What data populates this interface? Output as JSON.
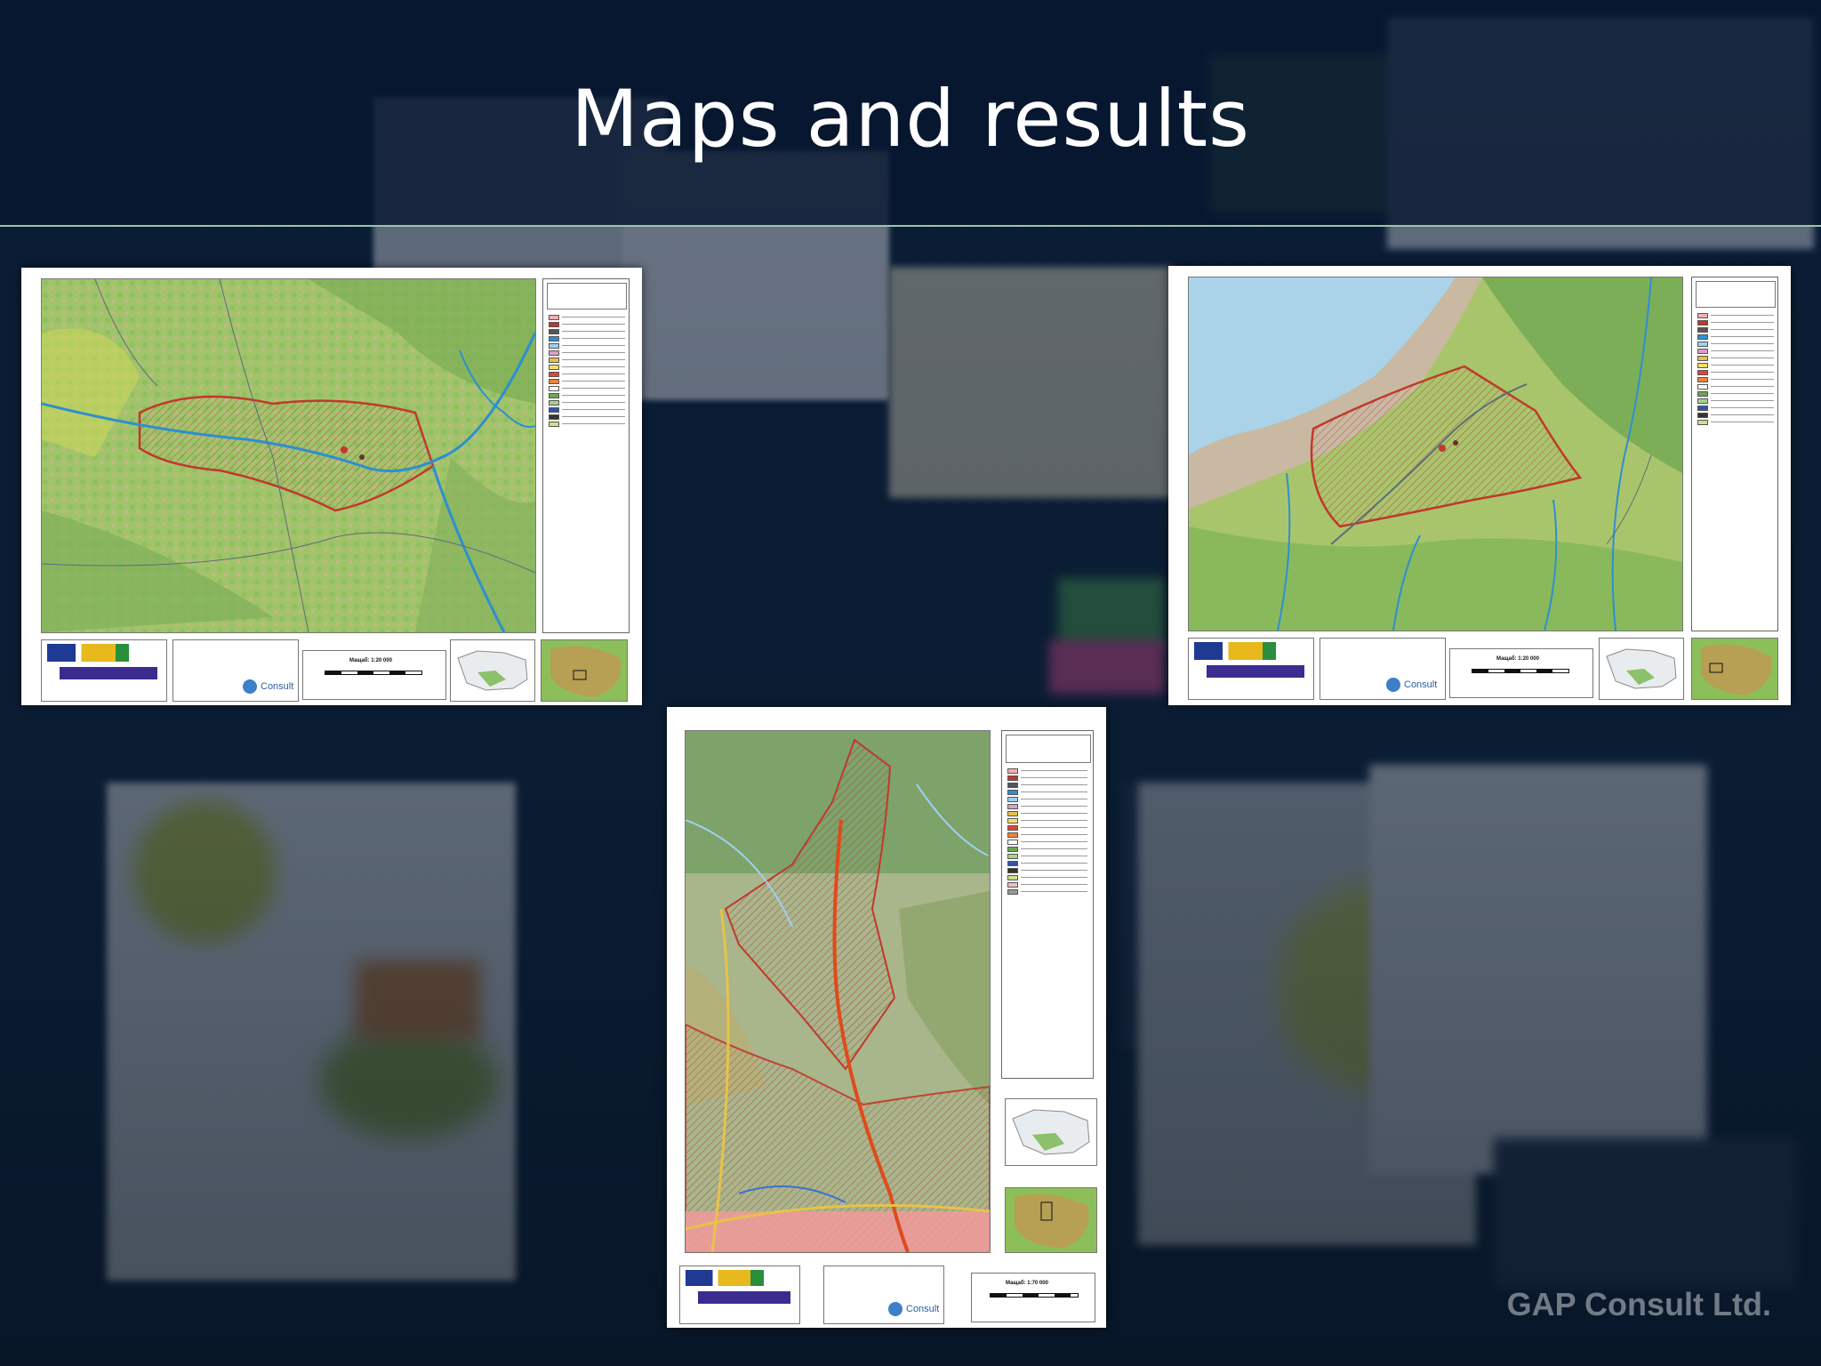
{
  "slide": {
    "title": "Maps and results",
    "watermark": "GAP Consult Ltd.",
    "colors": {
      "title_band": "#06162f",
      "title_text": "#ffffff",
      "divider": "#9cc6a6",
      "flood_zone": "#c0392b",
      "water": "#2d8fd0"
    }
  },
  "maps": [
    {
      "orientation": "landscape",
      "scale_label": "Мащаб: 1:20 000",
      "logo_label": "Consult"
    },
    {
      "orientation": "landscape",
      "scale_label": "Мащаб: 1:20 000",
      "logo_label": "Consult"
    },
    {
      "orientation": "portrait",
      "scale_label": "Мащаб: 1:70 000",
      "logo_label": "Consult"
    }
  ]
}
